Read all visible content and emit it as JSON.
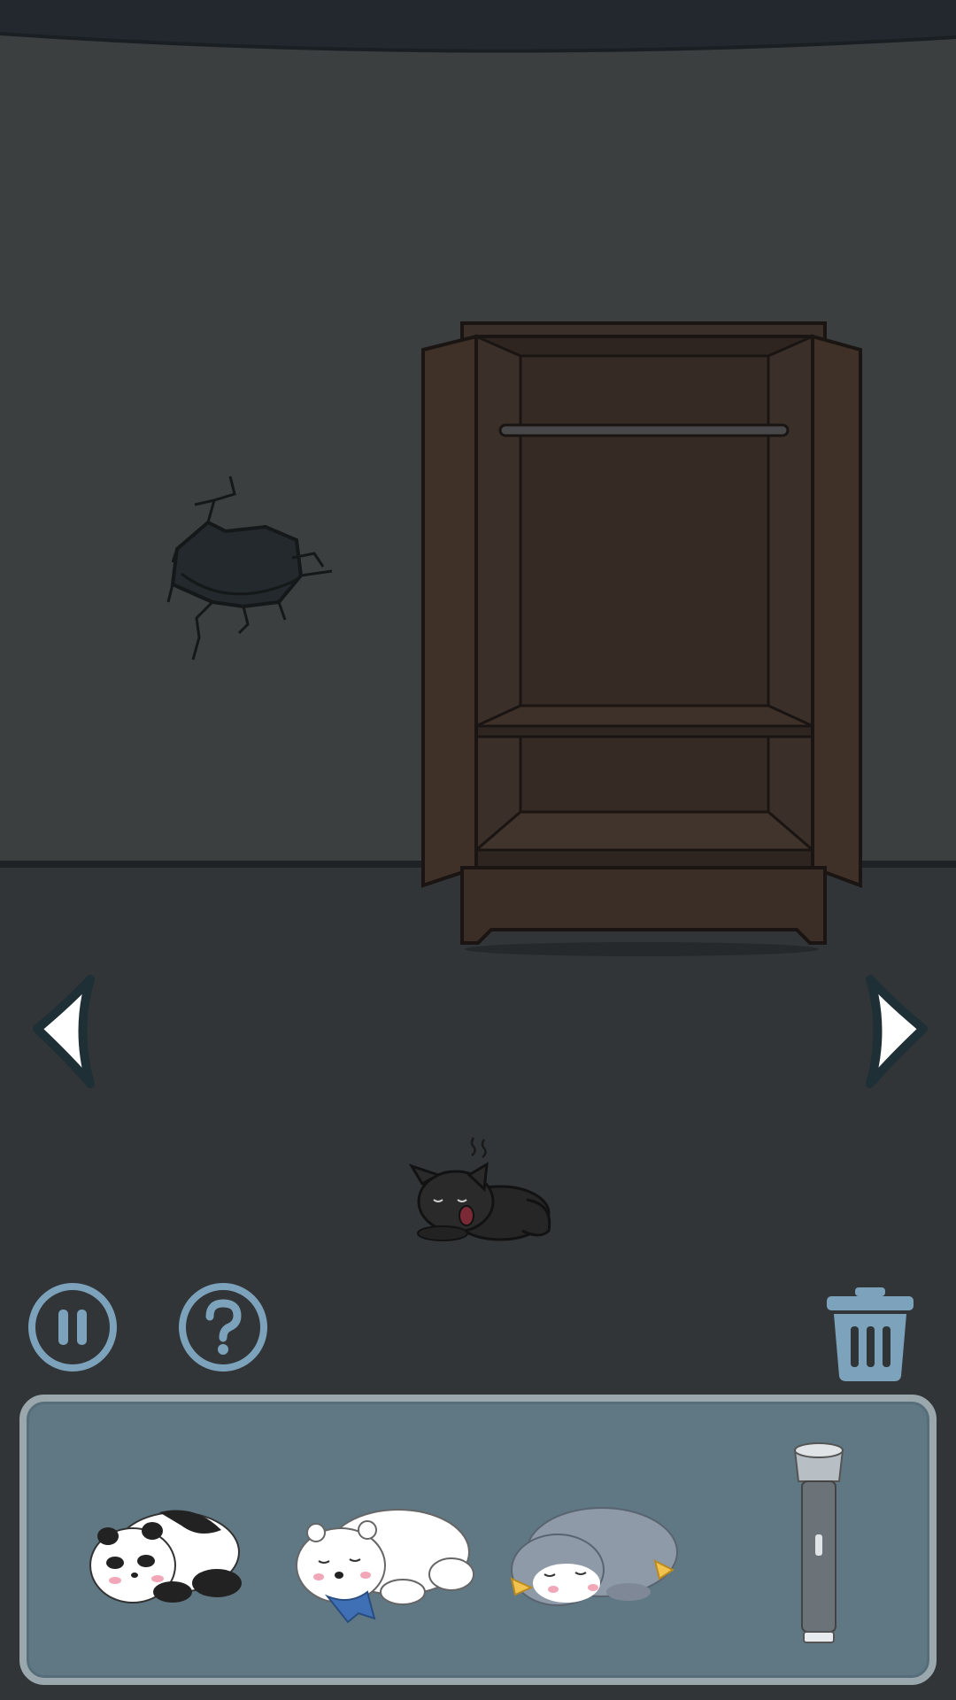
{
  "scene": {
    "wall_color": "#3c3f40",
    "floor_color": "#323538",
    "hotspots": [
      "wall-hole",
      "open-wardrobe",
      "sleeping-black-cat"
    ]
  },
  "navigation": {
    "left_icon": "chevron-left-icon",
    "right_icon": "chevron-right-icon"
  },
  "controls": {
    "pause_icon": "pause-icon",
    "help_icon": "question-mark-icon",
    "trash_icon": "trash-icon",
    "accent_color": "#7ca3bb"
  },
  "inventory": {
    "background_color": "#5f7884",
    "items": [
      {
        "id": "panda-plush",
        "icon": "panda-icon"
      },
      {
        "id": "polar-bear-plush",
        "icon": "polar-bear-icon"
      },
      {
        "id": "penguin-plush",
        "icon": "penguin-icon"
      },
      {
        "id": "flashlight",
        "icon": "flashlight-icon"
      }
    ]
  }
}
